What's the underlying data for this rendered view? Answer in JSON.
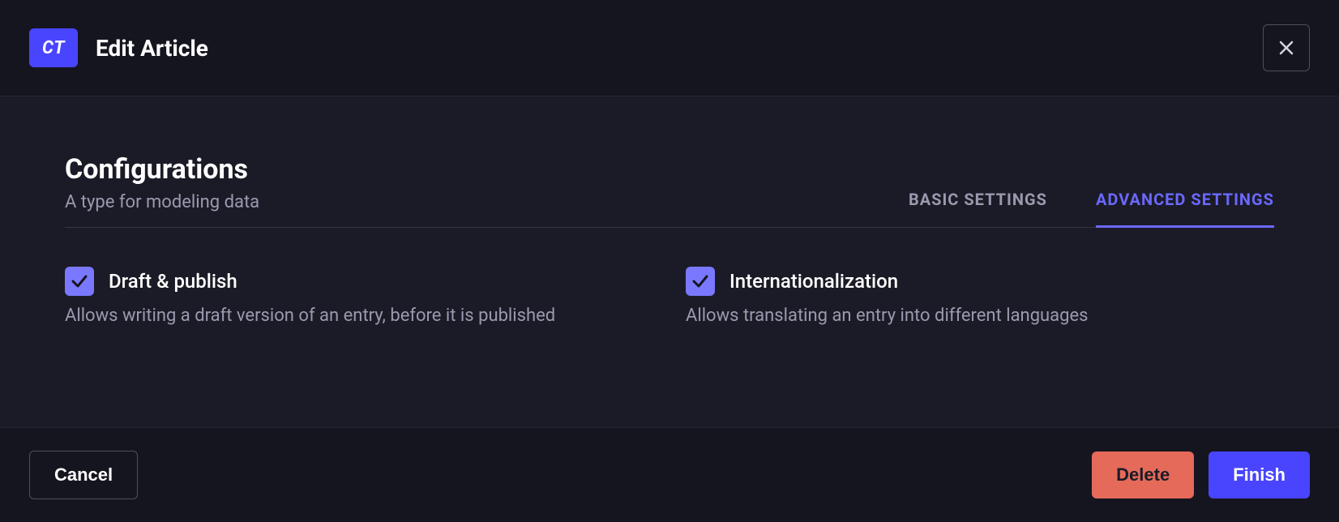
{
  "header": {
    "badge": "CT",
    "title": "Edit Article"
  },
  "config": {
    "title": "Configurations",
    "subtitle": "A type for modeling data"
  },
  "tabs": {
    "basic": "BASIC SETTINGS",
    "advanced": "ADVANCED SETTINGS"
  },
  "options": {
    "draft": {
      "label": "Draft & publish",
      "desc": "Allows writing a draft version of an entry, before it is published"
    },
    "i18n": {
      "label": "Internationalization",
      "desc": "Allows translating an entry into different languages"
    }
  },
  "footer": {
    "cancel": "Cancel",
    "delete": "Delete",
    "finish": "Finish"
  }
}
